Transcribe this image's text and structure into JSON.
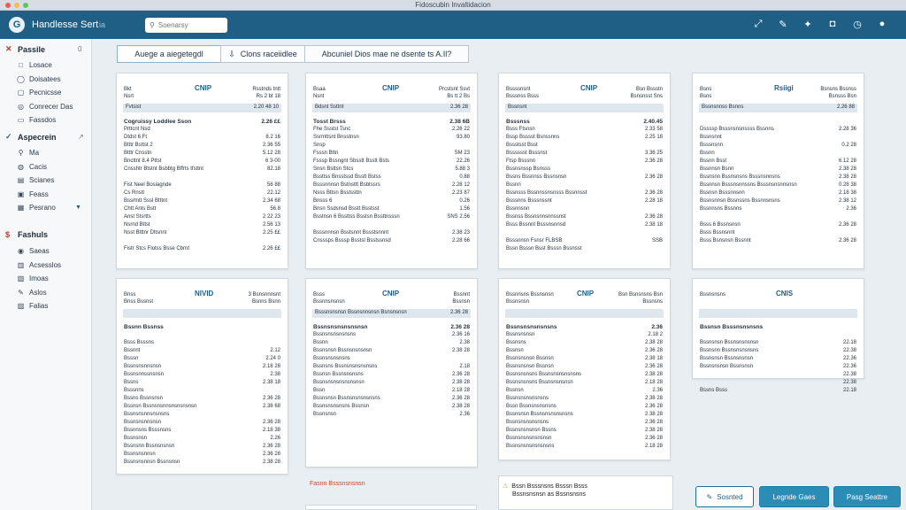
{
  "window": {
    "title": "Fidoscubin Invaltidacion"
  },
  "app": {
    "name": "Handlesse Sert",
    "sub": "ia",
    "logo": "G"
  },
  "search": {
    "placeholder": "Soenarsy"
  },
  "topbar_icons": [
    "expand-icon",
    "pin-icon",
    "twitter-icon",
    "pocket-icon",
    "clock-icon",
    "user-icon"
  ],
  "sidebar": {
    "sections": [
      {
        "label": "Passile",
        "mark": "✕",
        "mark_color": "#c0392b",
        "count": "0",
        "items": [
          {
            "label": "Losace",
            "icon": "□"
          },
          {
            "label": "Doisatees",
            "icon": "◯"
          },
          {
            "label": "Pecnicsse",
            "icon": "▢"
          },
          {
            "label": "Conrecer Das",
            "icon": "◎"
          },
          {
            "label": "Fassdos",
            "icon": "▭"
          }
        ]
      },
      {
        "label": "Aspecrein",
        "mark": "✓",
        "mark_color": "#1f6f98",
        "count": "↗",
        "items": [
          {
            "label": "Ma",
            "icon": "⚲"
          },
          {
            "label": "Cacis",
            "icon": "◍"
          },
          {
            "label": "Scianes",
            "icon": "▤"
          },
          {
            "label": "Feass",
            "icon": "▣"
          },
          {
            "label": "Pesrano",
            "icon": "▦",
            "dropdown": "▼"
          }
        ]
      },
      {
        "label": "Fashuls",
        "mark": "$",
        "mark_color": "#c0392b",
        "count": "",
        "items": [
          {
            "label": "Saeas",
            "icon": "◉"
          },
          {
            "label": "Acsesslos",
            "icon": "▥"
          },
          {
            "label": "Imoas",
            "icon": "▧"
          },
          {
            "label": "Aslos",
            "icon": "✎"
          },
          {
            "label": "Falias",
            "icon": "▨"
          }
        ]
      }
    ]
  },
  "tabs": [
    {
      "label": "Auege a aiegetegdl",
      "icon": ""
    },
    {
      "label": "Clons raceiidlee",
      "icon": "⇩"
    },
    {
      "label": "Abcuniel Dios mae ne dsente ts A.Il?",
      "icon": ""
    }
  ],
  "cards": [
    {
      "brand": "CNIP",
      "hdr_l": [
        "Bkt",
        "Nsrt"
      ],
      "hdr_r": [
        "Rsstnds tntt",
        "Rs 2 bt 18"
      ],
      "band": [
        "Fvtsist",
        "2.20 48 10"
      ],
      "rows": [
        [
          "Cogruissy Loddlee Sson",
          "2.26 ££"
        ],
        [
          "Prttcnt Nsd",
          ""
        ],
        [
          "Dtdst 6 Ft",
          "8.2 16"
        ],
        [
          "Btttr Bsttst 2",
          "2.36 55"
        ],
        [
          "Btttr Cnsstn",
          "5.12 28"
        ],
        [
          "Bncttnt 8.4 Pttst",
          "6 3-00"
        ],
        [
          "Cnsshtr Btstnt Bsbbtg Bffrts tfsttnt",
          "82.18"
        ],
        [
          "",
          ""
        ],
        [
          "Fist Neel Bosiagnde",
          "56 88"
        ],
        [
          "Cs Rnstt",
          "22.12"
        ],
        [
          "Bssrtntt Sssl Btttnt",
          "2.34 68"
        ],
        [
          "Chtt Ants Bstt",
          "56.8"
        ],
        [
          "Anst Stsrtts",
          "2 22 23"
        ],
        [
          "Nsrnd Bttst",
          "2.56 13"
        ],
        [
          "Nsst Btttnr Dltsnnt",
          "2.25 ££"
        ],
        [
          "",
          ""
        ],
        [
          "Fistr Stcs Flotss Bsse Cbrnt",
          "2.26 ££"
        ]
      ]
    },
    {
      "brand": "CNIP",
      "hdr_l": [
        "Bsaa",
        "Nsnt"
      ],
      "hdr_r": [
        "Prcstsnt Ssvt",
        "Bs tt 2 Bs"
      ],
      "band": [
        "Bdsnt Ssttnt",
        "2.36 28"
      ],
      "rows": [
        [
          "Tosst Brsss",
          "2.38 6B"
        ],
        [
          "Fhe Ssstst Tsnc",
          "2.26 22"
        ],
        [
          "Ssrmttsnt Bnsstnsn",
          "93.80"
        ],
        [
          "Snsp",
          ""
        ],
        [
          "Fsssn Bttn",
          "SM 23"
        ],
        [
          "Fsssp Bssngnt Sbsstt Bsstt Bsts",
          "22.26"
        ],
        [
          "Snsn Bsttsn Stcs",
          "5.88 3"
        ],
        [
          "Bssttss Bnsstssd Bsstt Bstss",
          "0.88"
        ],
        [
          "Bsssnnnsn Bstnsttt Bsbtssrs",
          "2.28 12"
        ],
        [
          "Nsss Bttsn Bsstssttn",
          "2.23 87"
        ],
        [
          "Bnsss 6",
          "0.26"
        ],
        [
          "Bnsn Ssdsnsd Bsstt Bsstsst",
          "1.56"
        ],
        [
          "Bsstnsn 6 Bssttss Bsstsn Bssttnsssn",
          "SNS 2.56"
        ],
        [
          "",
          ""
        ],
        [
          "Bsssnnnsn Bsstsnnt Bssstsnnnt",
          "2.38 23"
        ],
        [
          "Cnsssps Bsssp Bsstsl Bsstssnsd",
          "2.28 66"
        ]
      ]
    },
    {
      "brand": "CNIP",
      "hdr_l": [
        "Bssssnsnt",
        "Bsssnss Bsss"
      ],
      "hdr_r": [
        "Bsn Bssstn",
        "Bsnsnsst Sns"
      ],
      "band": [
        "Bssnsnt",
        ""
      ],
      "rows": [
        [
          "Bsssnss",
          "2.40.45"
        ],
        [
          "Bsss Ftsnsn",
          "2.33 58"
        ],
        [
          "Bssp Bsssst Bsnssnns",
          "2.25 18"
        ],
        [
          "Bssstsst Bsst",
          ""
        ],
        [
          "Bsssssst Bsssnst",
          "3.36 25"
        ],
        [
          "Ftsp Bsssnn",
          "2.36 28"
        ],
        [
          "Bssnsnssp Bsnsss",
          ""
        ],
        [
          "Bssns Bssnnss Bssnsnsn",
          "2.36 28"
        ],
        [
          "Bssnn",
          ""
        ],
        [
          "Bssnsss Bssnnssnsnsss Bssnnsst",
          "2.36 28"
        ],
        [
          "Bsssnns Bsssnssnt",
          "2.28 18"
        ],
        [
          "Bssnnsnn",
          ""
        ],
        [
          "Bssnss Bssnsnnsnnssnst",
          "2.36 28"
        ],
        [
          "Bsss Bssnnt Bsssnsnnsd",
          "2.38 18"
        ],
        [
          "",
          ""
        ],
        [
          "Bsssnnsn Fsnsr FLBSB",
          "SSB"
        ],
        [
          "Bssn Bsssn Bsst Bsssn Bssnsst",
          ""
        ]
      ]
    },
    {
      "brand": "Rsiigi",
      "hdr_l": [
        "Bsns",
        "Bsns"
      ],
      "hdr_r": [
        "Bsnsns Bssnss",
        "Bsnsss Bsn"
      ],
      "band": [
        "Bssnsnnss Bsnns",
        "2.26 88"
      ],
      "rows": [
        [
          "",
          ""
        ],
        [
          "Dssssp Bsssnsnsnssss Bssnns",
          "2.28 36"
        ],
        [
          "Bssnsnnt",
          ""
        ],
        [
          "Bsssnsnn",
          "0.2 28"
        ],
        [
          "Bssnn",
          ""
        ],
        [
          "Bssnn Bsst",
          "6.12 28"
        ],
        [
          "Bssnnsn Bsnn",
          "2.38 28"
        ],
        [
          "Bssnsnn Bssnsnsns Bsssnsnnsns",
          "2.38 28"
        ],
        [
          "Bssnnsn Bsssnsnnssns Bsssnsnsnnsnsn",
          "0.28 38"
        ],
        [
          "Bssnsn Bsssnnsnn",
          "2.18 38"
        ],
        [
          "Bssnsnnsn Bssnssns Bssnnsnsns",
          "2.38 12"
        ],
        [
          "Bssnnsns Bssnns",
          "2.36"
        ],
        [
          "",
          ""
        ],
        [
          "Bsss 6 Bssnsnsn",
          "2.36 28"
        ],
        [
          "Bsss Bssnsnnt",
          ""
        ],
        [
          "Bsss Bsnsnsn Bssnnt",
          "2.36 28"
        ]
      ]
    },
    {
      "brand": "NIVID",
      "hdr_l": [
        "Bnss",
        "Bnss Bssnst"
      ],
      "hdr_r": [
        "3 Bsnsnnnsnt",
        "Bsnns Bsnn"
      ],
      "band": [
        "",
        ""
      ],
      "rows": [
        [
          "Bssnn Bssnss",
          ""
        ],
        [
          "",
          ""
        ],
        [
          "Bsss Bsssns",
          ""
        ],
        [
          "Bssnnt",
          "2.12"
        ],
        [
          "Bsssn",
          "2.24 0"
        ],
        [
          "Bssnsnsnnsnsn",
          "2.18 28"
        ],
        [
          "Bssnsnnssnsnsn",
          "2.38"
        ],
        [
          "Bssns",
          "2.38 18"
        ],
        [
          "Bsssnns",
          ""
        ],
        [
          "Bssns Bssnsnsn",
          "2.36 28"
        ],
        [
          "Bssnsn Bssnsnsnnsnsnsnsnsn",
          "2.38 68"
        ],
        [
          "Bssnsnsnnsnsnsns",
          ""
        ],
        [
          "Bssnsnsnnsnsn",
          "2.36 28"
        ],
        [
          "Bssnnsns Bsssnsns",
          "2.18 38"
        ],
        [
          "Bssnsnsn",
          "2.26"
        ],
        [
          "Bssnsnn Bssnsnsnsn",
          "2.36 28"
        ],
        [
          "Bssnsnsnnsn",
          "2.36 28"
        ],
        [
          "Bssnsnsnnsn Bssnsnsn",
          "2.38 28"
        ]
      ]
    },
    {
      "brand": "CNIP",
      "hdr_l": [
        "Bsss",
        "Bssnnsnsnsn"
      ],
      "hdr_r": [
        "Bssnnt",
        "Bssnsn"
      ],
      "band": [
        "Bsssnsnsnsn Bssnsnnsnsn Bsnsnsnsn",
        "2.36 28"
      ],
      "rows": [
        [
          "Bssnsnsnsnsnsnsn",
          "2.36 28"
        ],
        [
          "Bssnsnsnsnsnsns",
          "2.36 16"
        ],
        [
          "Bssnn",
          "2.38"
        ],
        [
          "Bssnsnsn Bssnsnsnsnsn",
          "2.38 28"
        ],
        [
          "Bssnsnsnsnsns",
          ""
        ],
        [
          "Bssnsns Bssnsnsnsnsnsns",
          "2.18"
        ],
        [
          "Bssnsn Bssnsnsnsns",
          "2.36 28"
        ],
        [
          "Bssnsnsnsnsnsnsnsn",
          "2.38 28"
        ],
        [
          "Bssn",
          "2.18 28"
        ],
        [
          "Bssnsnsn Bssnsnsnsnsnsns",
          "2.36 28"
        ],
        [
          "Bssnsnsnsnsns Bssnsn",
          "2.38 28"
        ],
        [
          "Bssnsnsn",
          "2.36"
        ]
      ]
    },
    {
      "brand": "CNIP",
      "hdr_l": [
        "Bssnnsns Bssnsnsn",
        "Bssnsnsn"
      ],
      "hdr_r": [
        "Bsn Bsnsnsns Bsn",
        "Bssnsns"
      ],
      "band": [
        "",
        ""
      ],
      "rows": [
        [
          "Bssnsnsnsnsnsns",
          "2.36"
        ],
        [
          "Bssnsnsnsn",
          "2.18 2"
        ],
        [
          "Bssnsns",
          "2.38 28"
        ],
        [
          "Bssnsn",
          "2.36 28"
        ],
        [
          "Bssnsnsnsn Bssnsn",
          "2.38 18"
        ],
        [
          "Bssnsnsnsn Bssnsn",
          "2.36 28"
        ],
        [
          "Bssnsnsnsns Bssnsnsnsnsnsns",
          "2.38 28"
        ],
        [
          "Bssnsnsnsns Bssnsnsnsnsn",
          "2.18 28"
        ],
        [
          "Bssnsn",
          "2.36"
        ],
        [
          "Bssnsnsnsnsnsns",
          "2.38 28"
        ],
        [
          "Bssn Bssnsnsnsnsns",
          "2.36 28"
        ],
        [
          "Bssnsnsn Bssnsnsnsnsnsns",
          "2.38 28"
        ],
        [
          "Bssnsnsnsnsnsns",
          "2.36 28"
        ],
        [
          "Bssnsnsnsnsn Bssns",
          "2.38 28"
        ],
        [
          "Bssnsnsnsnsnsnsn",
          "2.36 28"
        ],
        [
          "Bssnsnsnsnsnsnsns",
          "2.18 28"
        ]
      ]
    },
    {
      "brand": "CNIS",
      "hdr_l": [
        "Bssnsnsns",
        ""
      ],
      "hdr_r": [
        "",
        ""
      ],
      "band": [
        "",
        ""
      ],
      "rows": [
        [
          "Bssnsn Bsssnsnsnsns",
          ""
        ],
        [
          "",
          ""
        ],
        [
          "Bssnsnsn Bssnsnsnsnsn",
          "22.18"
        ],
        [
          "Bssnsnn Bssnsnsnsnsns",
          "22.38"
        ],
        [
          "Bssnsnsn Bssnsnsnsn",
          "22.36"
        ],
        [
          "Bssnsnsnsn Bssnsnsn",
          "22.36"
        ],
        [
          "",
          "22.38"
        ],
        [
          "",
          "22.38"
        ],
        [
          "Bssns Bsss",
          "22.18"
        ]
      ]
    }
  ],
  "bottom": {
    "label": "Fasnn Bsssnsnsnsn",
    "notice_lines": [
      "Bssn Bsssnsns Bsssn Bsss",
      "Bssnsnsnsn as Bssnsnsns"
    ],
    "buttons": [
      {
        "label": "Sosnted",
        "icon": "✎",
        "style": "outline"
      },
      {
        "label": "Legnde Gaes",
        "icon": "",
        "style": "solid"
      },
      {
        "label": "Pasg Seattre",
        "icon": "",
        "style": "solid"
      }
    ]
  }
}
